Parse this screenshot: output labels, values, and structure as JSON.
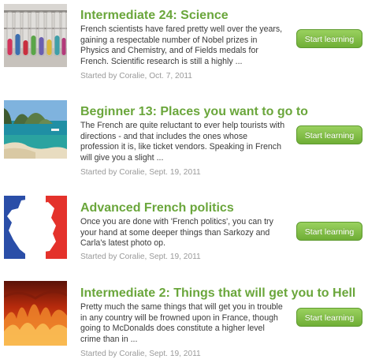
{
  "lessons": [
    {
      "title": "Intermediate 24: Science",
      "description": "French scientists have fared pretty well over the years, gaining a respectable number of Nobel prizes in Physics and Chemistry, and of Fields medals for French. Scientific research is still a highly ...",
      "meta": "Started by Coralie, Oct. 7, 2011",
      "button_label": "Start learning",
      "thumbnail": "test-tubes-image"
    },
    {
      "title": "Beginner 13: Places you want to go to",
      "description": "The French are quite reluctant to ever help tourists with directions - and that includes the ones whose profession it is, like ticket vendors. Speaking in French will give you a slight ...",
      "meta": "Started by Coralie, Sept. 19, 2011",
      "button_label": "Start learning",
      "thumbnail": "tropical-bay-image"
    },
    {
      "title": "Advanced French politics",
      "description": "Once you are done with 'French politics', you can try your hand at some deeper things than Sarkozy and Carla's latest photo op.",
      "meta": "Started by Coralie, Sept. 19, 2011",
      "button_label": "Start learning",
      "thumbnail": "france-flag-map-image"
    },
    {
      "title": "Intermediate 2: Things that will get you to Hell",
      "description": "Pretty much the same things that will get you in trouble in any country will be frowned upon in France, though going to McDonalds does constitute a higher level crime than in ...",
      "meta": "Started by Coralie, Sept. 19, 2011",
      "button_label": "Start learning",
      "thumbnail": "fire-image"
    }
  ],
  "colors": {
    "title": "#6aa63b",
    "button": "#7ab843",
    "meta": "#9a9a9a"
  }
}
